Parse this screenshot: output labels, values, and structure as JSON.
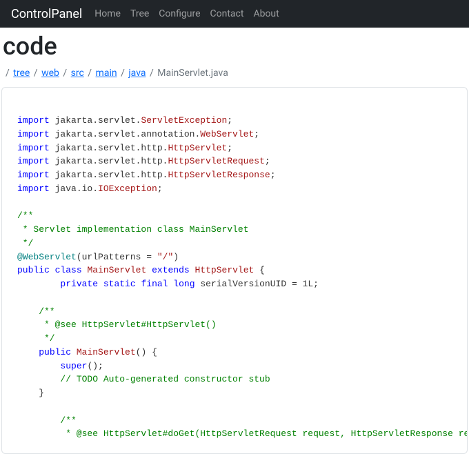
{
  "navbar": {
    "brand": "ControlPanel",
    "items": [
      "Home",
      "Tree",
      "Configure",
      "Contact",
      "About"
    ]
  },
  "page": {
    "title": "code"
  },
  "breadcrumb": {
    "sep": "/",
    "links": [
      "tree",
      "web",
      "src",
      "main",
      "java"
    ],
    "current": "MainServlet.java"
  },
  "code": {
    "kw_import": "import",
    "kw_public": "public",
    "kw_class": "class",
    "kw_extends": "extends",
    "kw_private": "private",
    "kw_static": "static",
    "kw_final": "final",
    "kw_long": "long",
    "kw_super": "super",
    "pkg_servlet": " jakarta.servlet.",
    "pkg_annotation": " jakarta.servlet.annotation.",
    "pkg_http": " jakarta.servlet.http.",
    "pkg_javaio": " java.io.",
    "cls_ServletException": "ServletException",
    "cls_WebServlet": "WebServlet",
    "cls_HttpServlet": "HttpServlet",
    "cls_HttpServletRequest": "HttpServletRequest",
    "cls_HttpServletResponse": "HttpServletResponse",
    "cls_IOException": "IOException",
    "cls_MainServlet": "MainServlet",
    "com_doc1a": "/**",
    "com_doc1b": " * Servlet implementation class MainServlet",
    "com_doc1c": " */",
    "ann_WebServlet": "@WebServlet",
    "ann_args_pre": "(urlPatterns = ",
    "ann_args_str": "\"/\"",
    "ann_args_post": ")",
    "open_brace": " {",
    "line_serial": " serialVersionUID = 1L;",
    "com_doc2a": "    /**",
    "com_doc2b": "     * @see HttpServlet#HttpServlet()",
    "com_doc2c": "     */",
    "ctor_sig": "() {",
    "ctor_super": "();",
    "com_todo": "        // TODO Auto-generated constructor stub",
    "brace_close4": "    }",
    "com_doc3a": "        /**",
    "com_doc3b": "         * @see HttpServlet#doGet(HttpServletRequest request, HttpServletResponse response)",
    "semi": ";"
  }
}
